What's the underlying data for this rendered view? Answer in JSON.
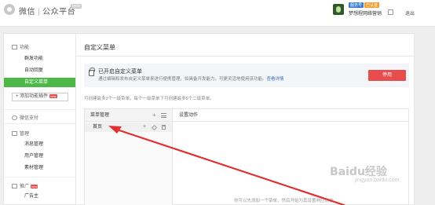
{
  "header": {
    "brand_wechat": "微信",
    "brand_separator": "|",
    "brand_platform": "公众平台",
    "beta_tag": "beta",
    "badge_subscription": "服务号",
    "badge_verified": "已认证",
    "account_name": "梦想程网络营销",
    "logout": "退出"
  },
  "sidebar": {
    "sections": [
      {
        "label": "功能",
        "icon": "grid-icon"
      },
      {
        "label": "微信支付",
        "icon": "pay-icon"
      },
      {
        "label": "管理",
        "icon": "manage-icon"
      },
      {
        "label": "推广",
        "icon": "promo-icon",
        "tag": "new"
      }
    ],
    "feature_items": [
      "群发功能",
      "自动回复",
      "自定义菜单"
    ],
    "active_item": "自定义菜单",
    "add_plugin": "+ 添加功能插件",
    "add_plugin_tag": "new",
    "manage_items": [
      "消息管理",
      "用户管理",
      "素材管理"
    ],
    "promo_items": [
      "广告主"
    ]
  },
  "main": {
    "title": "自定义菜单",
    "notice_title": "已开启自定义菜单",
    "notice_desc": "通过编辑和发布自定义菜单来进行便携管理，如具备开发能力，可更灵活地使用该功能。",
    "notice_link": "查看详情",
    "disable_button": "停用",
    "hint": "可创建最多3个一级菜单，每个一级菜单下可创建最多5个二级菜单。",
    "menu_header": "菜单管理",
    "action_header": "设置动作",
    "menu_rows": [
      "首页"
    ],
    "footnote": "你可以先添加一个菜单，然后开始为其设置响应动作"
  },
  "watermark": {
    "logo": "Baidu经验",
    "url": "jingyan.baidu.com"
  },
  "colors": {
    "active_green": "#4cb848",
    "disable_red": "#e84d4d",
    "annotation_red": "#e03030",
    "link_blue": "#3b6fc4"
  }
}
